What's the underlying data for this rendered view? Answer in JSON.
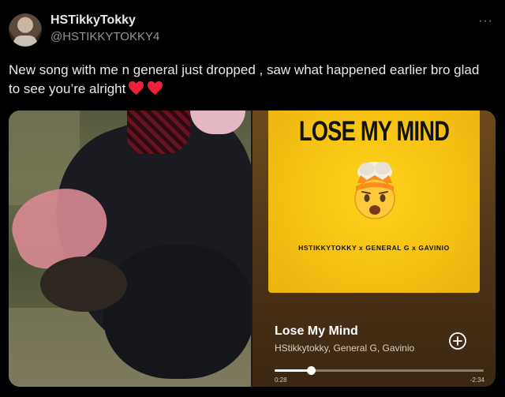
{
  "tweet": {
    "display_name": "HSTikkyTokky",
    "handle": "@HSTIKKYTOKKY4",
    "more_icon": "more-horizontal-icon",
    "text": "New song with me n general just dropped , saw what happened earlier bro glad to see you’re alright",
    "emojis": [
      "red-heart",
      "red-heart"
    ]
  },
  "media": {
    "video": {
      "description_icon": "video-thumbnail"
    },
    "player": {
      "cover_title": "LOSE MY MIND",
      "cover_artists": "HSTIKKYTOKKY x GENERAL G x GAVINIO",
      "cover_emoji": "exploding-head",
      "song_title": "Lose My Mind",
      "song_artists": "HStikkytokky, General G, Gavinio",
      "add_icon": "plus-circle-icon",
      "time_elapsed": "0:28",
      "time_remaining": "-2:34",
      "progress_fraction": 0.173
    }
  },
  "colors": {
    "background": "#000000",
    "text_primary": "#e7e9ea",
    "text_secondary": "#8f969c",
    "heart": "#f91880",
    "cover_yellow": "#f7c515",
    "player_brown": "#4c3317"
  }
}
